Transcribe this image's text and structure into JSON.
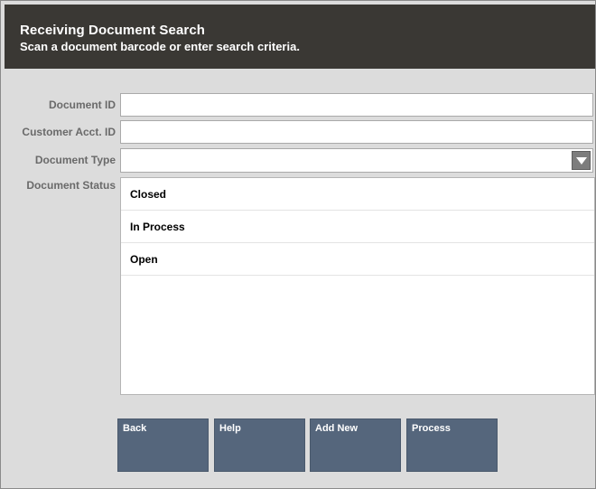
{
  "header": {
    "title": "Receiving Document Search",
    "subtitle": "Scan a document barcode or enter search criteria."
  },
  "form": {
    "document_id": {
      "label": "Document ID",
      "value": ""
    },
    "customer_acct_id": {
      "label": "Customer Acct. ID",
      "value": ""
    },
    "document_type": {
      "label": "Document Type",
      "value": ""
    },
    "document_status": {
      "label": "Document Status",
      "options": [
        "Closed",
        "In Process",
        "Open"
      ]
    }
  },
  "buttons": {
    "back": "Back",
    "help": "Help",
    "add_new": "Add New",
    "process": "Process"
  },
  "colors": {
    "header_bg": "#3a3834",
    "button_bg": "#55667c",
    "panel_bg": "#dcdcdc"
  },
  "icons": {
    "document_type_dropdown": "chevron-down-icon"
  }
}
